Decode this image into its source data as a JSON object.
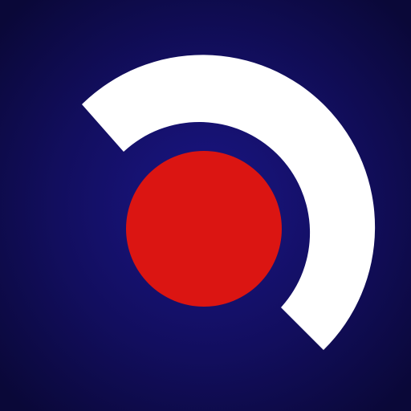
{
  "icon": {
    "name": "app-logo-icon",
    "colors": {
      "background_center": "#1A1585",
      "background_mid": "#120E5E",
      "background_edge": "#0A0838",
      "arc": "#FFFFFF",
      "dot": "#DB1512"
    }
  }
}
